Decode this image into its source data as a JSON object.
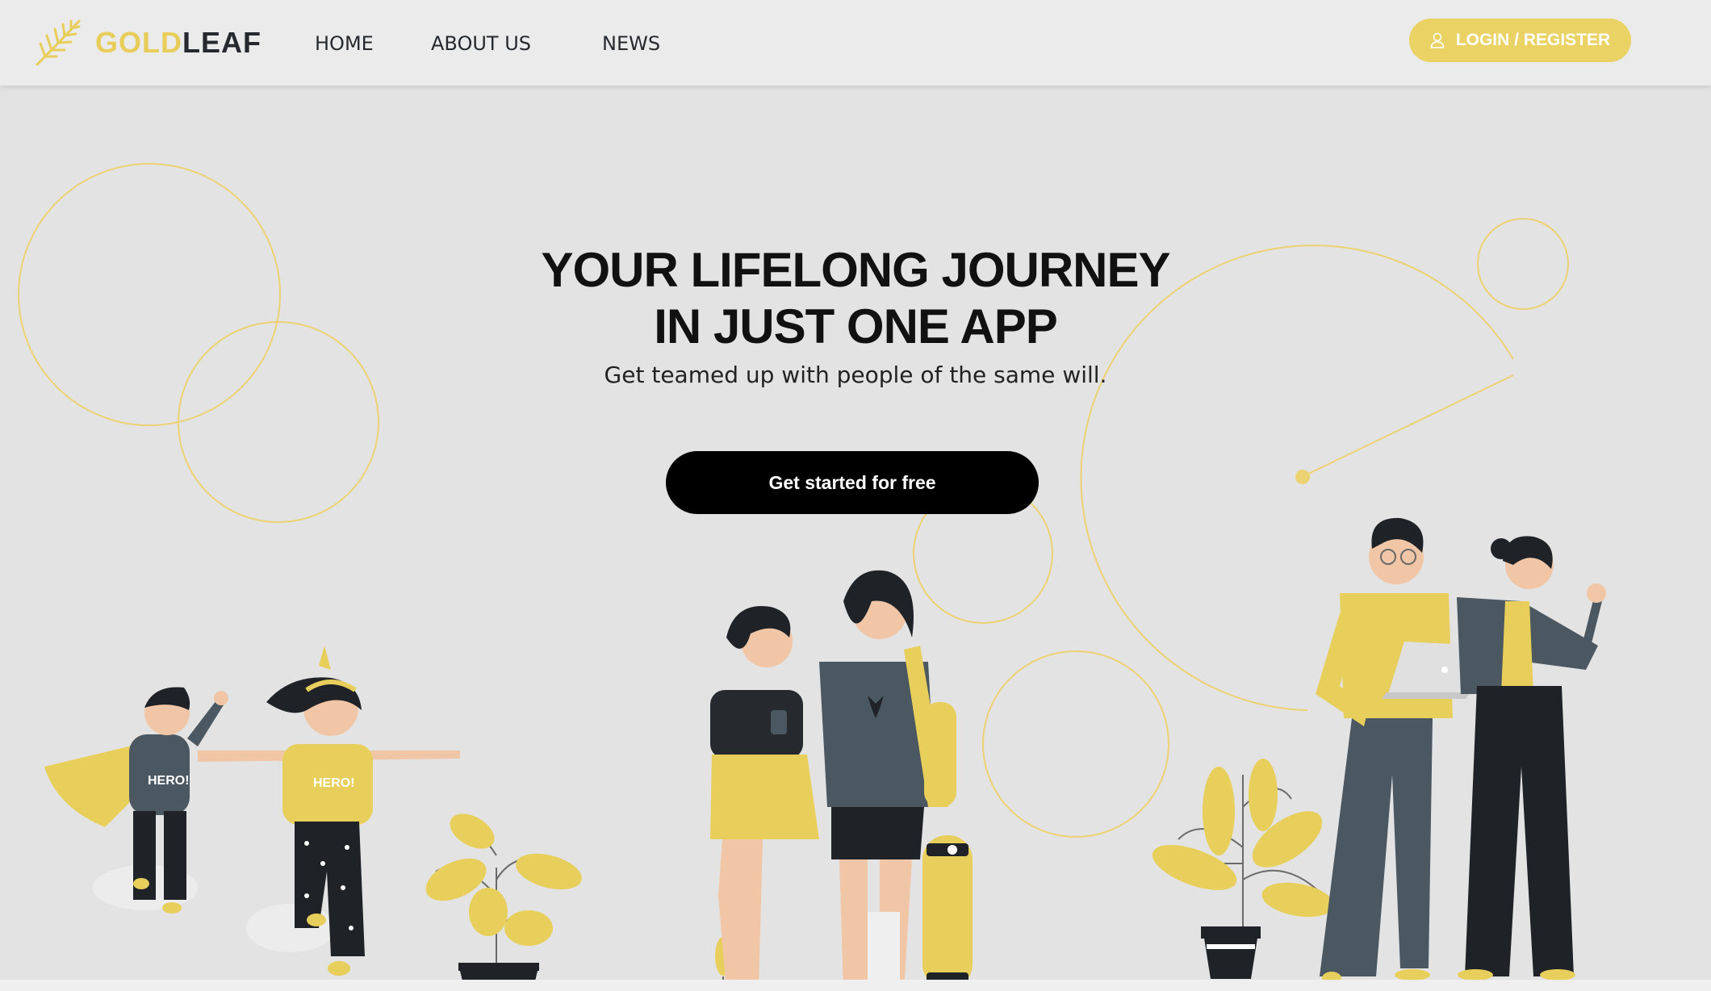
{
  "brand": {
    "name_part1": "GOLD",
    "name_part2": "LEAF",
    "logo_icon": "leaf-icon"
  },
  "nav": {
    "links": [
      {
        "label": "HOME"
      },
      {
        "label": "ABOUT US"
      },
      {
        "label": "NEWS"
      }
    ]
  },
  "login": {
    "label": "LOGIN / REGISTER",
    "icon": "user-icon"
  },
  "hero": {
    "title_line1": "YOUR LIFELONG JOURNEY",
    "title_line2": "IN JUST ONE APP",
    "subtitle": "Get teamed up with people of the same will.",
    "cta_label": "Get started for free"
  },
  "illustrations": {
    "shirt_text": "HERO!"
  },
  "colors": {
    "accent": "#ead264",
    "dark": "#26292d",
    "background": "#e3e3e3",
    "cta": "#000000"
  }
}
